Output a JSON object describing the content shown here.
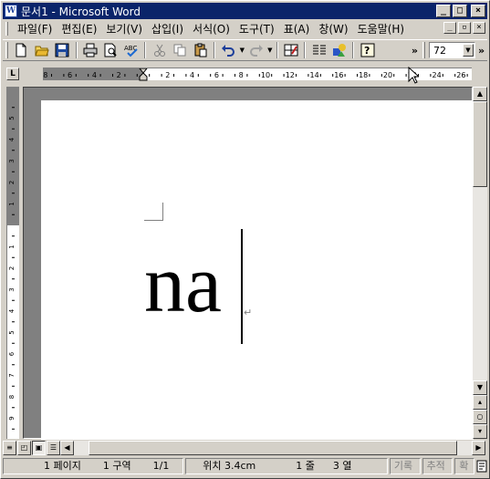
{
  "window": {
    "title": "문서1 - Microsoft Word",
    "app_icon_letter": "W"
  },
  "title_buttons": {
    "minimize": "_",
    "maximize": "□",
    "close": "×"
  },
  "menu": {
    "items": [
      {
        "label": "파일(F)"
      },
      {
        "label": "편집(E)"
      },
      {
        "label": "보기(V)"
      },
      {
        "label": "삽입(I)"
      },
      {
        "label": "서식(O)"
      },
      {
        "label": "도구(T)"
      },
      {
        "label": "표(A)"
      },
      {
        "label": "창(W)"
      },
      {
        "label": "도움말(H)"
      }
    ]
  },
  "toolbar": {
    "zoom_value": "72",
    "more_label": "»"
  },
  "ruler": {
    "left_labels": [
      "8",
      "6",
      "4",
      "2"
    ],
    "right_labels": [
      "2",
      "4",
      "6",
      "8",
      "10",
      "12",
      "14",
      "16",
      "18",
      "20",
      "22",
      "24",
      "26"
    ],
    "vertical_labels_top": [
      "5",
      "4",
      "3",
      "2",
      "1"
    ],
    "vertical_labels_bottom": [
      "1",
      "2",
      "3",
      "4",
      "5",
      "6",
      "7",
      "8",
      "9"
    ],
    "tab_selector": "L"
  },
  "document": {
    "text": "na",
    "paragraph_mark": "↵"
  },
  "status": {
    "page": "1 페이지",
    "section": "1 구역",
    "page_of": "1/1",
    "position": "위치 3.4cm",
    "line": "1 줄",
    "column": "3 열",
    "rec": "기록",
    "trk": "추적",
    "ext": "확",
    "ovr_icon": "book-icon"
  },
  "colors": {
    "title_bar": "#0a246a",
    "face": "#d4d0c8",
    "workspace": "#808080"
  }
}
